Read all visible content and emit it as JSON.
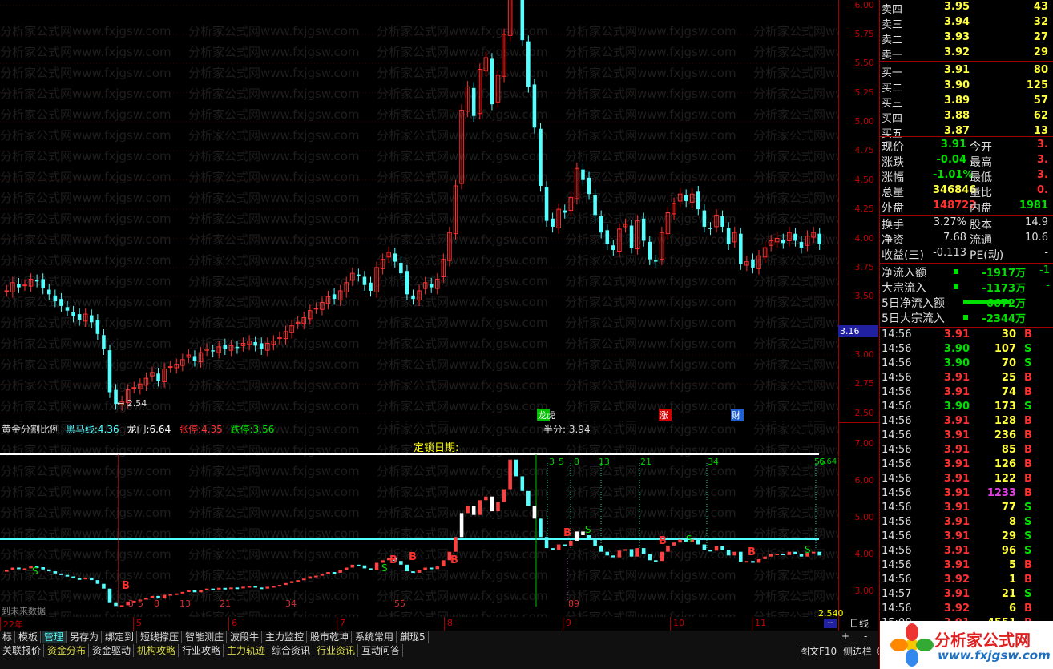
{
  "upper_axis": {
    "labels": [
      "6.25",
      "6.00",
      "5.75",
      "5.50",
      "5.25",
      "5.00",
      "4.75",
      "4.50",
      "4.25",
      "4.00",
      "3.75",
      "3.50",
      "3.00",
      "2.75",
      "2.50"
    ],
    "current_price_tag": "3.16"
  },
  "upper_chart": {
    "low_marker": "2.54",
    "events": [
      "龙虎",
      "涨",
      "财"
    ]
  },
  "indicator_bar": {
    "name": "黄金分割比例",
    "heima_label": "黑马线:",
    "heima_value": "4.36",
    "longmen_label": "龙门:",
    "longmen_value": "6.64",
    "zhangting_label": "张停:",
    "zhangting_value": "4.35",
    "dieting_label": "跌停:",
    "dieting_value": "3.56",
    "banfen_label": "半分:",
    "banfen_value": "3.94"
  },
  "lower_axis": {
    "labels": [
      "7.00",
      "6.00",
      "5.00",
      "4.00",
      "3.00"
    ],
    "corner_value": "2.540"
  },
  "lower_chart": {
    "title_text": "定锁日期:",
    "fib_top": [
      "3",
      "5",
      "8",
      "13",
      "21",
      "34",
      "55"
    ],
    "fib_bottom": [
      "3",
      "5",
      "8",
      "13",
      "21",
      "34",
      "55",
      "89"
    ],
    "no_data_text": "到未来数据",
    "buy_letter": "B",
    "sell_letter": "S",
    "top_value": "6.64"
  },
  "x_axis": {
    "labels": [
      "22年",
      "5",
      "6",
      "7",
      "8",
      "9",
      "10",
      "11"
    ],
    "period": "日线"
  },
  "tabs_row1": [
    "标",
    "模板",
    "管理",
    "另存为",
    "绑定到",
    "短线撑压",
    "智能测庄",
    "波段牛",
    "主力监控",
    "股市乾坤",
    "系统常用",
    "麒珑5"
  ],
  "tabs_row2": [
    "关联报价",
    "资金分布",
    "资金驱动",
    "机构攻略",
    "行业攻略",
    "主力轨迹",
    "综合资讯",
    "行业资讯",
    "互动问答"
  ],
  "tab_right": [
    "图文F10",
    "侧边栏《"
  ],
  "tab_controls": [
    "+",
    "-"
  ],
  "order_book": {
    "sells": [
      {
        "label": "卖四",
        "price": "3.95",
        "vol": "43"
      },
      {
        "label": "卖三",
        "price": "3.94",
        "vol": "32"
      },
      {
        "label": "卖二",
        "price": "3.93",
        "vol": "27"
      },
      {
        "label": "卖一",
        "price": "3.92",
        "vol": "29"
      }
    ],
    "buys": [
      {
        "label": "买一",
        "price": "3.91",
        "vol": "80"
      },
      {
        "label": "买二",
        "price": "3.90",
        "vol": "125"
      },
      {
        "label": "买三",
        "price": "3.89",
        "vol": "57"
      },
      {
        "label": "买四",
        "price": "3.88",
        "vol": "62"
      },
      {
        "label": "买五",
        "price": "3.87",
        "vol": "13"
      }
    ]
  },
  "quote": [
    {
      "l1": "现价",
      "v1": "3.91",
      "l2": "今开",
      "v2": "3."
    },
    {
      "l1": "涨跌",
      "v1": "-0.04",
      "l2": "最高",
      "v2": "3."
    },
    {
      "l1": "涨幅",
      "v1": "-1.01%",
      "l2": "最低",
      "v2": "3."
    },
    {
      "l1": "总量",
      "v1": "346846",
      "l2": "量比",
      "v2": "0."
    },
    {
      "l1": "外盘",
      "v1": "148722",
      "l2": "内盘",
      "v2": "1981"
    }
  ],
  "fundamentals": [
    {
      "l1": "换手",
      "v1": "3.27%",
      "l2": "股本",
      "v2": "14.9"
    },
    {
      "l1": "净资",
      "v1": "7.68",
      "l2": "流通",
      "v2": "10.6"
    },
    {
      "l1": "收益(三)",
      "v1": "-0.113",
      "l2": "PE(动)",
      "v2": "-"
    }
  ],
  "flows": [
    {
      "label": "净流入额",
      "value": "-1917万",
      "extra": "-1"
    },
    {
      "label": "大宗流入",
      "value": "-1173万",
      "extra": "-"
    },
    {
      "label": "5日净流入额",
      "value": "-6672万",
      "extra": ""
    },
    {
      "label": "5日大宗流入",
      "value": "-2344万",
      "extra": ""
    }
  ],
  "ticks": [
    {
      "t": "14:56",
      "p": "3.91",
      "v": "30",
      "d": "B"
    },
    {
      "t": "14:56",
      "p": "3.90",
      "v": "107",
      "d": "S"
    },
    {
      "t": "14:56",
      "p": "3.90",
      "v": "70",
      "d": "S"
    },
    {
      "t": "14:56",
      "p": "3.91",
      "v": "25",
      "d": "B"
    },
    {
      "t": "14:56",
      "p": "3.91",
      "v": "74",
      "d": "B"
    },
    {
      "t": "14:56",
      "p": "3.90",
      "v": "173",
      "d": "S"
    },
    {
      "t": "14:56",
      "p": "3.91",
      "v": "128",
      "d": "B"
    },
    {
      "t": "14:56",
      "p": "3.91",
      "v": "236",
      "d": "B"
    },
    {
      "t": "14:56",
      "p": "3.91",
      "v": "85",
      "d": "B"
    },
    {
      "t": "14:56",
      "p": "3.91",
      "v": "126",
      "d": "B"
    },
    {
      "t": "14:56",
      "p": "3.91",
      "v": "122",
      "d": "B"
    },
    {
      "t": "14:56",
      "p": "3.91",
      "v": "1233",
      "d": "B"
    },
    {
      "t": "14:56",
      "p": "3.91",
      "v": "77",
      "d": "S"
    },
    {
      "t": "14:56",
      "p": "3.91",
      "v": "8",
      "d": "S"
    },
    {
      "t": "14:56",
      "p": "3.91",
      "v": "29",
      "d": "S"
    },
    {
      "t": "14:56",
      "p": "3.91",
      "v": "96",
      "d": "S"
    },
    {
      "t": "14:56",
      "p": "3.91",
      "v": "5",
      "d": "B"
    },
    {
      "t": "14:56",
      "p": "3.92",
      "v": "1",
      "d": "B"
    },
    {
      "t": "14:57",
      "p": "3.91",
      "v": "21",
      "d": "S"
    },
    {
      "t": "14:56",
      "p": "3.92",
      "v": "6",
      "d": "B"
    },
    {
      "t": "15:00",
      "p": "3.91",
      "v": "4551",
      "d": "B"
    }
  ],
  "watermark": "分析家公式网www.fxjgsw.com",
  "logo": {
    "name": "分析家公式网",
    "url": "www.fxjgsw.com"
  },
  "colors": {
    "up": "#ff3030",
    "down": "#54ffff",
    "axis": "#a00000",
    "yellow": "#ffff00",
    "green": "#00e000"
  }
}
